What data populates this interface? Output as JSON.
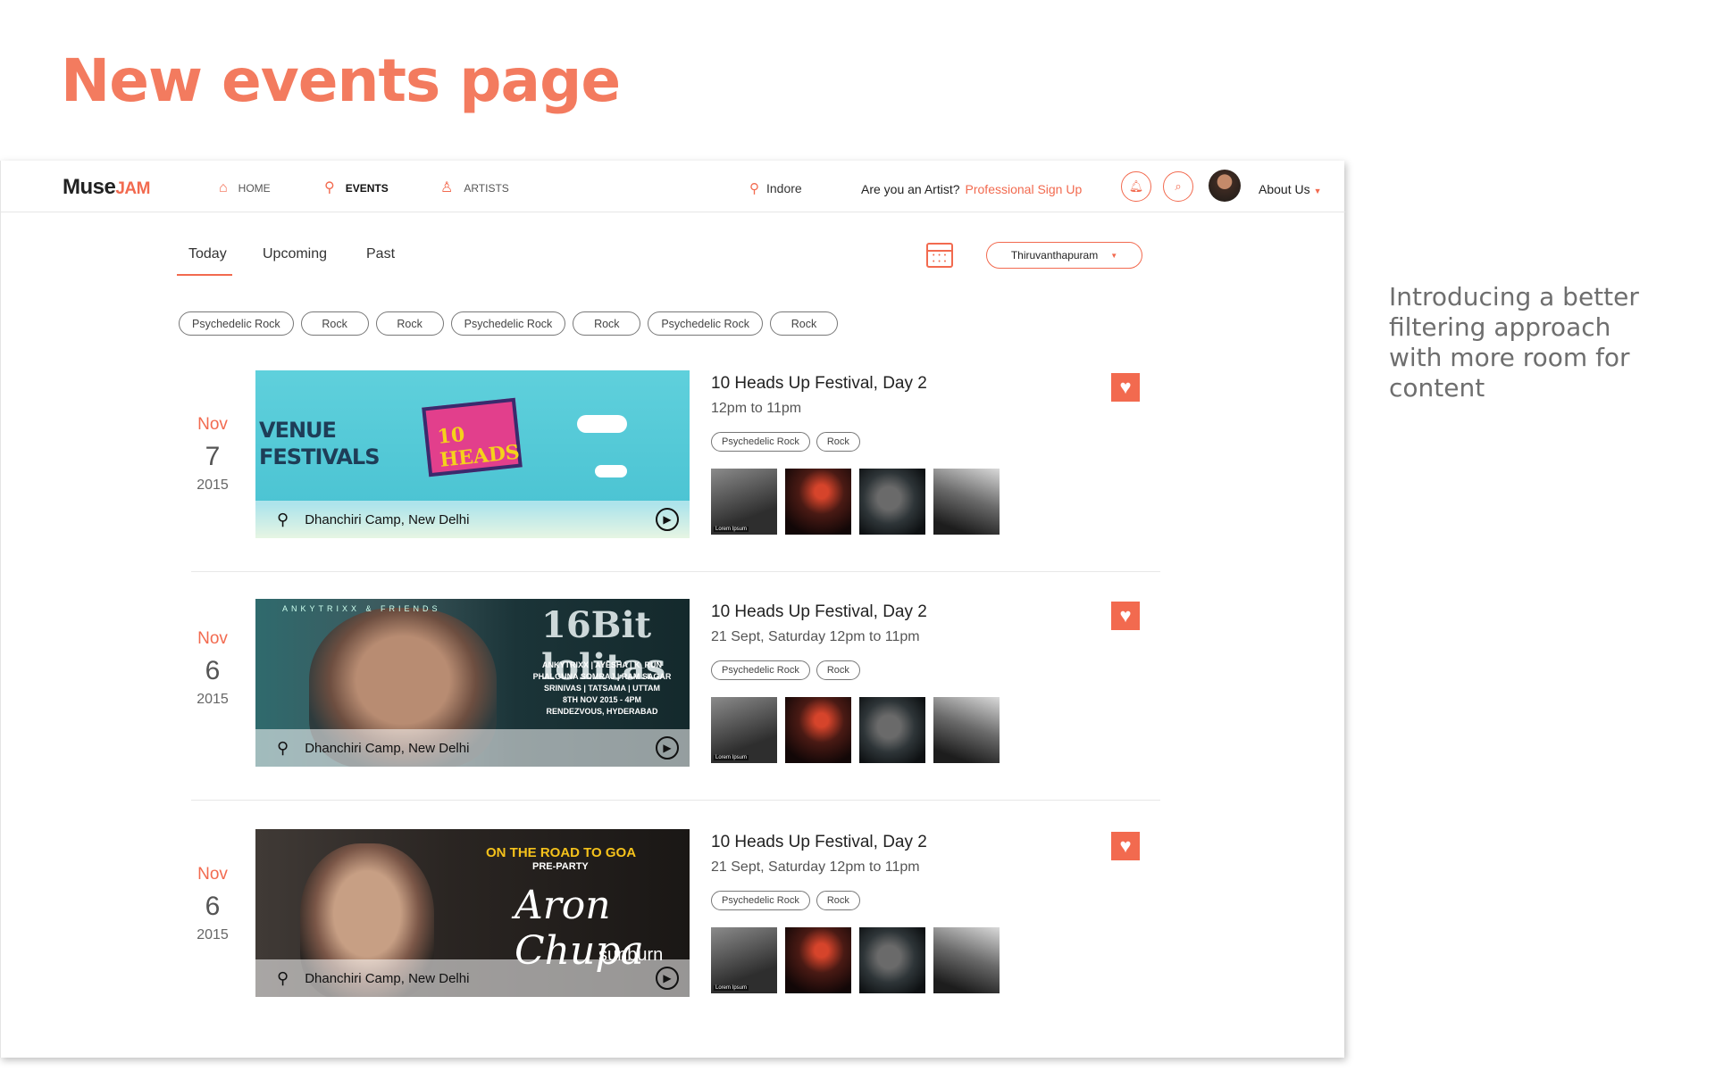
{
  "heading": "New events page",
  "side_note": "Introducing a better filtering approach with more room for content",
  "nav": {
    "logo_main": "Muse",
    "logo_accent": "JAM",
    "items": [
      {
        "label": "HOME",
        "icon": "home-icon"
      },
      {
        "label": "EVENTS",
        "icon": "microphone-icon"
      },
      {
        "label": "ARTISTS",
        "icon": "artist-icon"
      }
    ],
    "location": "Indore",
    "artist_question": "Are you an Artist?",
    "signup_link": "Professional Sign Up",
    "about": "About Us"
  },
  "tabs": [
    "Today",
    "Upcoming",
    "Past"
  ],
  "active_tab": "Today",
  "city_select": "Thiruvanthapuram",
  "filter_chips": [
    "Psychedelic Rock",
    "Rock",
    "Rock",
    "Psychedelic Rock",
    "Rock",
    "Psychedelic Rock",
    "Rock"
  ],
  "events": [
    {
      "month": "Nov",
      "day": "7",
      "year": "2015",
      "title": "10 Heads Up Festival, Day 2",
      "time": "12pm to 11pm",
      "location": "Dhanchiri Camp, New Delhi",
      "tags": [
        "Psychedelic Rock",
        "Rock"
      ],
      "banner": {
        "line1": "VENUE",
        "line2": "FESTIVALS",
        "badge": "10 HEADS"
      },
      "thumb_caption": "Lorem Ipsum"
    },
    {
      "month": "Nov",
      "day": "6",
      "year": "2015",
      "title": "10 Heads Up Festival, Day 2",
      "time": "21 Sept, Saturday 12pm to 11pm",
      "location": "Dhanchiri Camp, New Delhi",
      "tags": [
        "Psychedelic Rock",
        "Rock"
      ],
      "banner": {
        "kicker": "ANKYTRIXX & FRIENDS",
        "title": "16Bit lolitas",
        "lineup": "ANKYTRIXX | AYESHA | K_RUN PHALGUNA SOMRAJ | RAM SAGAR SRINIVAS | TATSAMA | UTTAM",
        "date": "8TH NOV 2015 - 4PM",
        "venue": "RENDEZVOUS, HYDERABAD"
      },
      "thumb_caption": "Lorem Ipsum"
    },
    {
      "month": "Nov",
      "day": "6",
      "year": "2015",
      "title": "10 Heads Up Festival, Day 2",
      "time": "21 Sept, Saturday 12pm to 11pm",
      "location": "Dhanchiri Camp, New Delhi",
      "tags": [
        "Psychedelic Rock",
        "Rock"
      ],
      "banner": {
        "head": "ON THE ROAD TO GOA",
        "sub": "PRE-PARTY",
        "signature": "Aron Chupa",
        "brand": "sunburn"
      },
      "thumb_caption": "Lorem Ipsum"
    }
  ],
  "colors": {
    "accent": "#f26a4f",
    "heading": "#f37b5f"
  }
}
